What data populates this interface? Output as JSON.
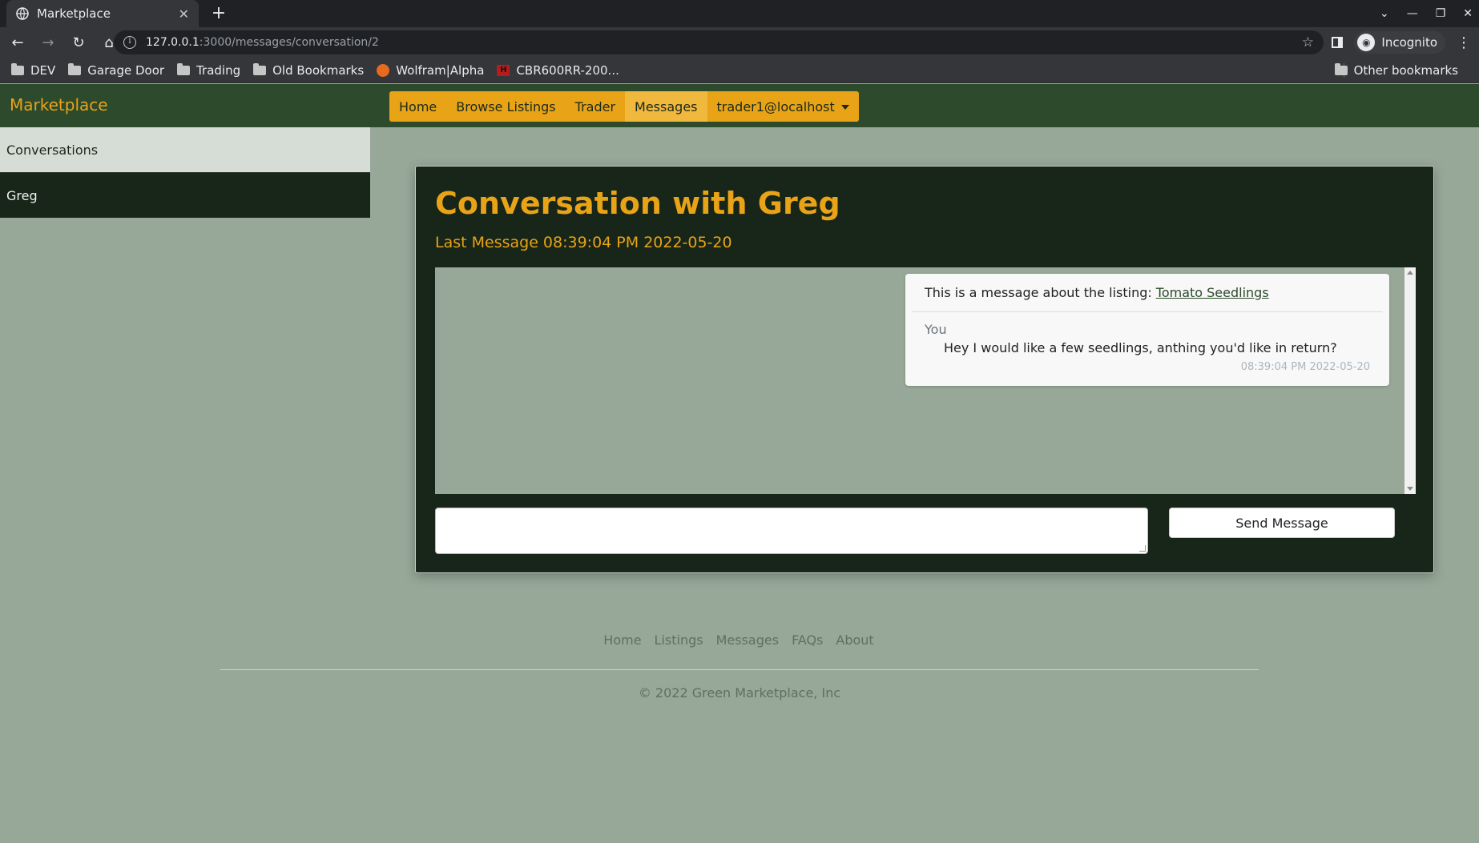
{
  "browser": {
    "tab_title": "Marketplace",
    "url_host": "127.0.0.1",
    "url_path": ":3000/messages/conversation/2",
    "profile_label": "Incognito",
    "bookmarks": [
      "DEV",
      "Garage Door",
      "Trading",
      "Old Bookmarks",
      "Wolfram|Alpha",
      "CBR600RR-200..."
    ],
    "other_bookmarks": "Other bookmarks"
  },
  "site": {
    "brand": "Marketplace",
    "menu": {
      "home": "Home",
      "browse": "Browse Listings",
      "trader": "Trader",
      "messages": "Messages",
      "account": "trader1@localhost"
    },
    "colors": {
      "accent": "#e8a317",
      "nav_bg": "#2d4a2c",
      "panel_bg": "#172619",
      "page_bg": "#97a898"
    }
  },
  "sidebar": {
    "header": "Conversations",
    "items": [
      {
        "label": "Greg"
      }
    ]
  },
  "conversation": {
    "title": "Conversation with Greg",
    "last_message": "Last Message 08:39:04 PM 2022-05-20",
    "message": {
      "listing_prefix": "This is a message about the listing:",
      "listing_name": "Tomato Seedlings",
      "sender": "You",
      "text": "Hey I would like a few seedlings, anthing you'd like in return?",
      "time": "08:39:04 PM 2022-05-20"
    },
    "send_label": "Send Message"
  },
  "footer": {
    "links": [
      "Home",
      "Listings",
      "Messages",
      "FAQs",
      "About"
    ],
    "copyright": "© 2022 Green Marketplace, Inc"
  }
}
